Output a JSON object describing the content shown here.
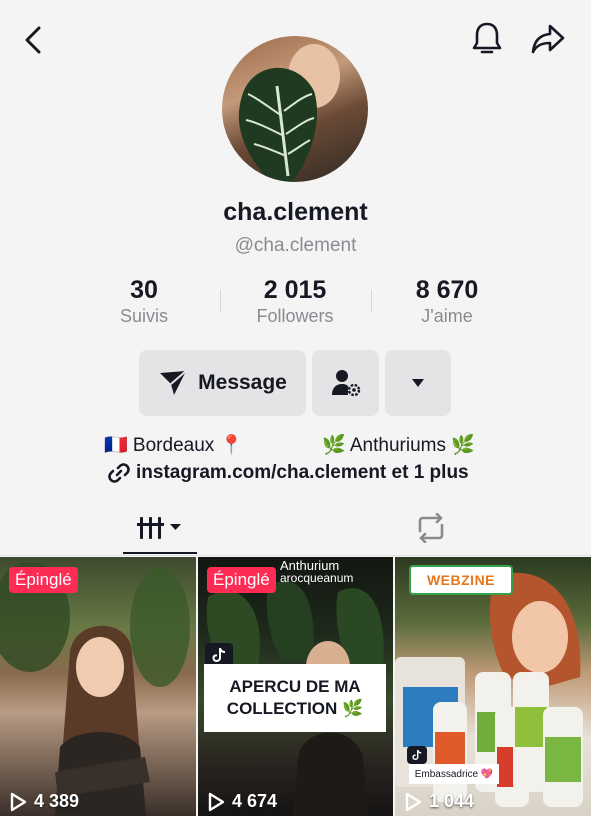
{
  "header": {
    "back_icon": "chevron-left-icon",
    "bell_icon": "bell-icon",
    "share_icon": "share-arrow-icon"
  },
  "profile": {
    "username": "cha.clement",
    "handle": "@cha.clement"
  },
  "stats": [
    {
      "value": "30",
      "label": "Suivis"
    },
    {
      "value": "2 015",
      "label": "Followers"
    },
    {
      "value": "8 670",
      "label": "J'aime"
    }
  ],
  "actions": {
    "message_label": "Message",
    "message_icon": "send-icon",
    "follow_icon": "person-gear-icon",
    "more_icon": "caret-down-icon"
  },
  "bio": {
    "location": "🇫🇷 Bordeaux 📍",
    "topic": "🌿 Anthuriums 🌿",
    "link": "instagram.com/cha.clement et 1 plus",
    "link_icon": "link-icon"
  },
  "tabs": {
    "videos_icon": "grid-bars-icon",
    "reposts_icon": "repost-icon"
  },
  "videos": [
    {
      "pinned_label": "Épinglé",
      "views": "4 389"
    },
    {
      "pinned_label": "Épinglé",
      "views": "4 674",
      "overlay_title": "Anthurium",
      "overlay_subtitle": "arocqueanum",
      "card_text": "APERCU DE MA COLLECTION 🌿"
    },
    {
      "views": "1 044",
      "brand": "WEBZINE",
      "tag": "Embassadrice 💖"
    }
  ],
  "colors": {
    "background": "#f4f4f4",
    "text": "#161823",
    "muted": "#8a8b91",
    "button": "#e4e4e6",
    "pin": "#fe2c55"
  }
}
